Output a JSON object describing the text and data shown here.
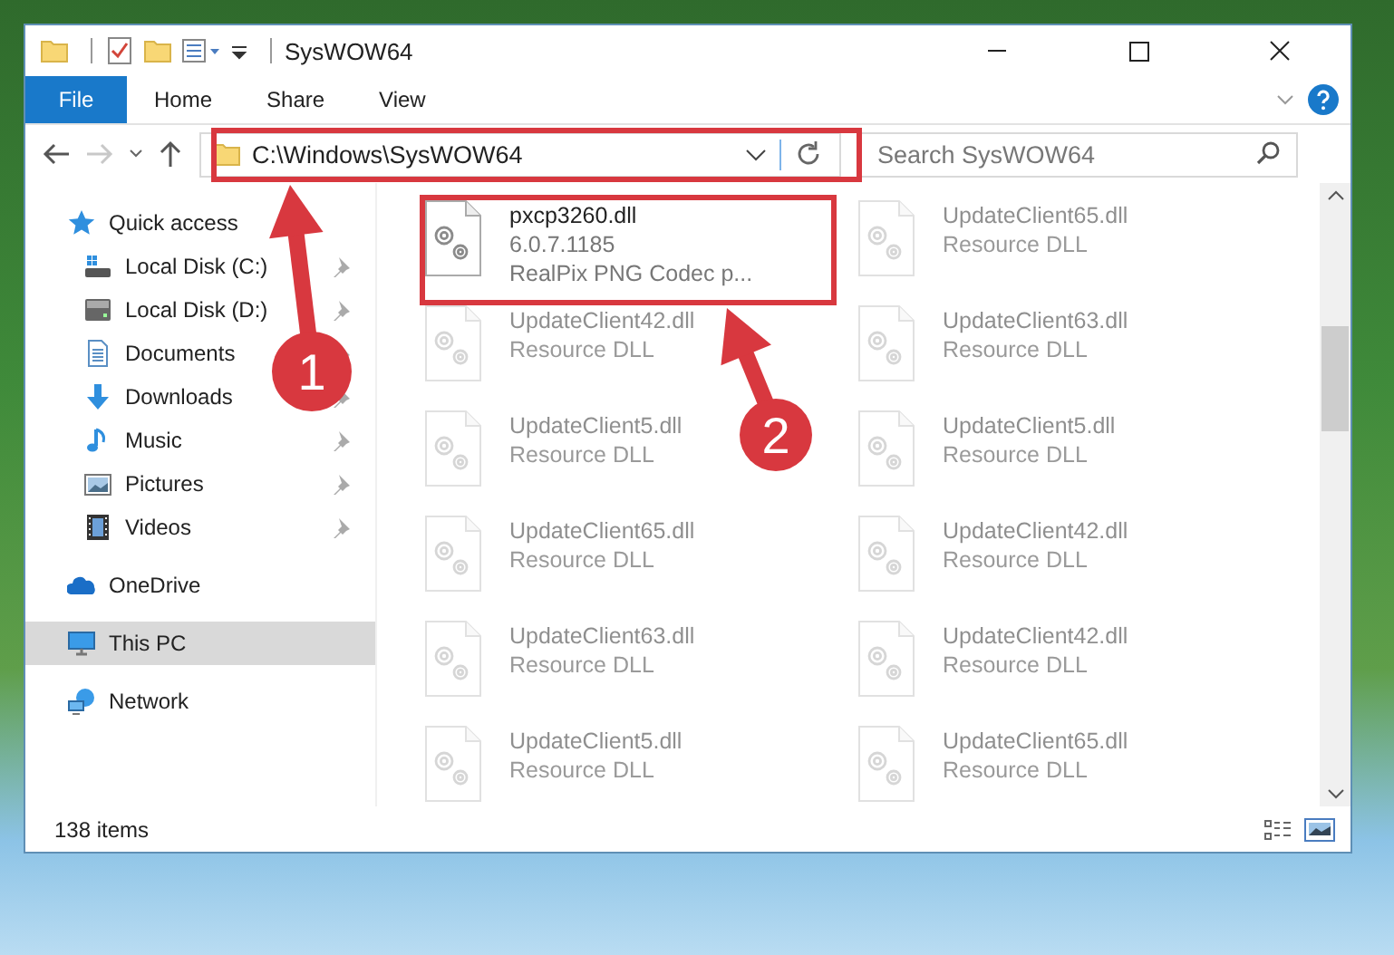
{
  "window": {
    "title": "SysWOW64"
  },
  "ribbon": {
    "tabs": [
      {
        "label": "File",
        "kind": "menu",
        "selected": false
      },
      {
        "label": "Home",
        "kind": "tab",
        "selected": false
      },
      {
        "label": "Share",
        "kind": "tab",
        "selected": false
      },
      {
        "label": "View",
        "kind": "tab",
        "selected": false
      }
    ]
  },
  "address_bar": {
    "path": "C:\\Windows\\SysWOW64"
  },
  "search": {
    "placeholder": "Search SysWOW64"
  },
  "nav_pane": {
    "items": [
      {
        "label": "Quick access",
        "selected": false,
        "children": [
          {
            "label": "Local Disk (C:)",
            "pinned": true,
            "selected": false
          },
          {
            "label": "Local Disk (D:)",
            "pinned": true,
            "selected": false
          },
          {
            "label": "Documents",
            "pinned": true,
            "selected": false
          },
          {
            "label": "Downloads",
            "pinned": true,
            "selected": false
          },
          {
            "label": "Music",
            "pinned": true,
            "selected": false
          },
          {
            "label": "Pictures",
            "pinned": true,
            "selected": false
          },
          {
            "label": "Videos",
            "pinned": true,
            "selected": false
          }
        ]
      },
      {
        "label": "OneDrive",
        "selected": false
      },
      {
        "label": "This PC",
        "selected": true
      },
      {
        "label": "Network",
        "selected": false
      }
    ]
  },
  "files": [
    {
      "name": "pxcp3260.dll",
      "details": [
        "6.0.7.1185",
        "RealPix PNG Codec p..."
      ],
      "dimmed": false
    },
    {
      "name": "UpdateClient65.dll",
      "details": [
        "Resource DLL"
      ],
      "dimmed": true
    },
    {
      "name": "UpdateClient42.dll",
      "details": [
        "Resource DLL"
      ],
      "dimmed": true
    },
    {
      "name": "UpdateClient63.dll",
      "details": [
        "Resource DLL"
      ],
      "dimmed": true
    },
    {
      "name": "UpdateClient5.dll",
      "details": [
        "Resource DLL"
      ],
      "dimmed": true
    },
    {
      "name": "UpdateClient5.dll",
      "details": [
        "Resource DLL"
      ],
      "dimmed": true
    },
    {
      "name": "UpdateClient65.dll",
      "details": [
        "Resource DLL"
      ],
      "dimmed": true
    },
    {
      "name": "UpdateClient42.dll",
      "details": [
        "Resource DLL"
      ],
      "dimmed": true
    },
    {
      "name": "UpdateClient63.dll",
      "details": [
        "Resource DLL"
      ],
      "dimmed": true
    },
    {
      "name": "UpdateClient42.dll",
      "details": [
        "Resource DLL"
      ],
      "dimmed": true
    },
    {
      "name": "UpdateClient5.dll",
      "details": [
        "Resource DLL"
      ],
      "dimmed": true
    },
    {
      "name": "UpdateClient65.dll",
      "details": [
        "Resource DLL"
      ],
      "dimmed": true
    }
  ],
  "status_bar": {
    "item_count": "138 items"
  },
  "annotations": [
    {
      "number": "1"
    },
    {
      "number": "2"
    }
  ]
}
